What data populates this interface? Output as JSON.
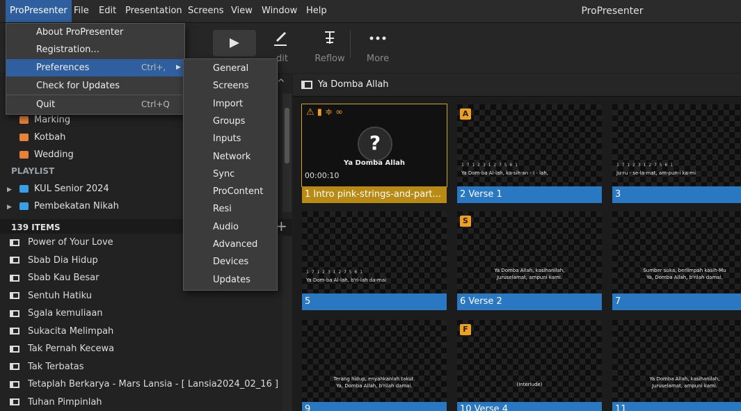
{
  "app": {
    "title": "ProPresenter",
    "menu": [
      "ProPresenter",
      "File",
      "Edit",
      "Presentation",
      "Screens",
      "View",
      "Window",
      "Help"
    ]
  },
  "toolbar": {
    "edit_label": "dit",
    "reflow_label": "Reflow",
    "more_label": "More"
  },
  "app_menu": {
    "items": [
      {
        "label": "About ProPresenter",
        "shortcut": ""
      },
      {
        "label": "Registration...",
        "shortcut": ""
      },
      {
        "label": "Preferences",
        "shortcut": "Ctrl+,"
      },
      {
        "label": "Check for Updates",
        "shortcut": ""
      },
      {
        "label": "Quit",
        "shortcut": "Ctrl+Q"
      }
    ]
  },
  "preferences_submenu": [
    "General",
    "Screens",
    "Import",
    "Groups",
    "Inputs",
    "Network",
    "Sync",
    "ProContent",
    "Resi",
    "Audio",
    "Advanced",
    "Devices",
    "Updates"
  ],
  "library": {
    "items": [
      "Marking",
      "Kotbah",
      "Wedding"
    ],
    "playlist_header": "PLAYLIST",
    "playlists": [
      "KUL Senior 2024",
      "Pembekatan Nikah"
    ]
  },
  "items": {
    "count_label": "139 ITEMS",
    "list": [
      "Power of Your Love",
      "Sbab Dia Hidup",
      "Sbab Kau Besar",
      "Sentuh Hatiku",
      "Sgala kemuliaan",
      "Sukacita Melimpah",
      "Tak Pernah Kecewa",
      "Tak Terbatas",
      "Tetaplah Berkarya - Mars Lansia - [ Lansia2024_02_16 ]",
      "Tuhan Pimpinlah"
    ]
  },
  "presentation": {
    "title": "Ya Domba Allah",
    "slides": [
      {
        "label": "1  Intro  pink-strings-and-part...",
        "badge": "",
        "text": "Ya Domba Allah",
        "time": "00:00:10",
        "lyric": ""
      },
      {
        "label": "2  Verse 1",
        "badge": "A",
        "text": "",
        "lyric": "Ya Dom-ba Al-lah,   ka-sih-an - i - lah,"
      },
      {
        "label": "3",
        "badge": "",
        "text": "",
        "lyric": "Ju-ru - se-la-mat, am-pun-i   ka-mi"
      },
      {
        "label": "5",
        "badge": "",
        "text": "",
        "lyric": "Ya Dom-ba Al-lah,  b'ri-lah da-mai"
      },
      {
        "label": "6  Verse 2",
        "badge": "S",
        "text": "Ya Domba Allah, kasihanilah,\nJuruselamat, ampuni kami.",
        "lyric": ""
      },
      {
        "label": "7",
        "badge": "",
        "text": "Sumber suka, berlimpah kasih-Mu\nYa, Domba Allah, b'rilah damai.",
        "lyric": ""
      },
      {
        "label": "9",
        "badge": "",
        "text": "Terang hidup, enyahkanlah takut.\nYa, Domba Allah, b'rilah damai.",
        "lyric": ""
      },
      {
        "label": "10  Verse 4",
        "badge": "F",
        "text": "(Interlude)",
        "lyric": ""
      },
      {
        "label": "11",
        "badge": "",
        "text": "Ya Domba Allah, kasihanilah,\nJuruselamat, ampuni kami.",
        "lyric": ""
      }
    ]
  },
  "colors": {
    "accent": "#2f5f9e",
    "slide_caption": "#2a78c2",
    "selected_caption": "#b98a14",
    "badge": "#f0a020"
  }
}
